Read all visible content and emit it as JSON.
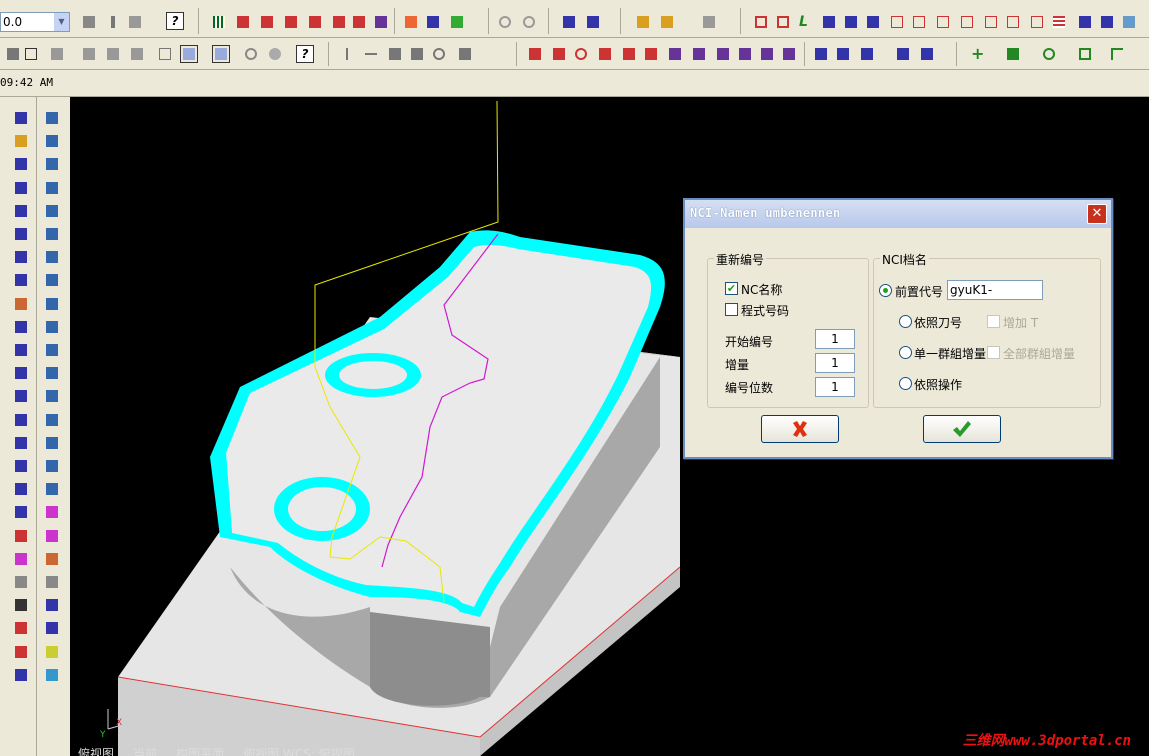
{
  "toolbar": {
    "zoom_value": "0.0",
    "clock": "09:42 AM"
  },
  "viewport": {
    "view_label": "俯视图 ... 当前 ... 构图平面 ... 俯视图  WCS: 俯视图",
    "watermark": "三维网www.3dportal.cn",
    "axis_labels": {
      "x": "X",
      "y": "Y"
    }
  },
  "dialog": {
    "title": "NCI-Namen umbenennen",
    "close_icon": "close-icon",
    "renumber_group": {
      "title": "重新编号",
      "nc_name_label": "NC名称",
      "nc_name_checked": true,
      "program_number_label": "程式号码",
      "program_number_checked": false,
      "start_number_label": "开始编号",
      "start_number_value": "1",
      "increment_label": "增量",
      "increment_value": "1",
      "digits_label": "编号位数",
      "digits_value": "1"
    },
    "nci_file_group": {
      "title": "NCI档名",
      "prefix_label": "前置代号",
      "prefix_value": "gyuK1-",
      "prefix_selected": true,
      "by_tool_label": "依照刀号",
      "add_t_label": "增加 T",
      "single_group_label": "单一群組增量",
      "all_groups_label": "全部群組增量",
      "by_operation_label": "依照操作"
    },
    "cancel_icon": "cancel-x-icon",
    "ok_icon": "ok-check-icon"
  },
  "colors": {
    "dialog_bg": "#ece9d8",
    "title_bar": "#b7c8ea",
    "toolpath_cyan": "#00ffff",
    "viewport_bg": "#000000",
    "cancel_red": "#e03010",
    "ok_green": "#2a9a2a"
  }
}
